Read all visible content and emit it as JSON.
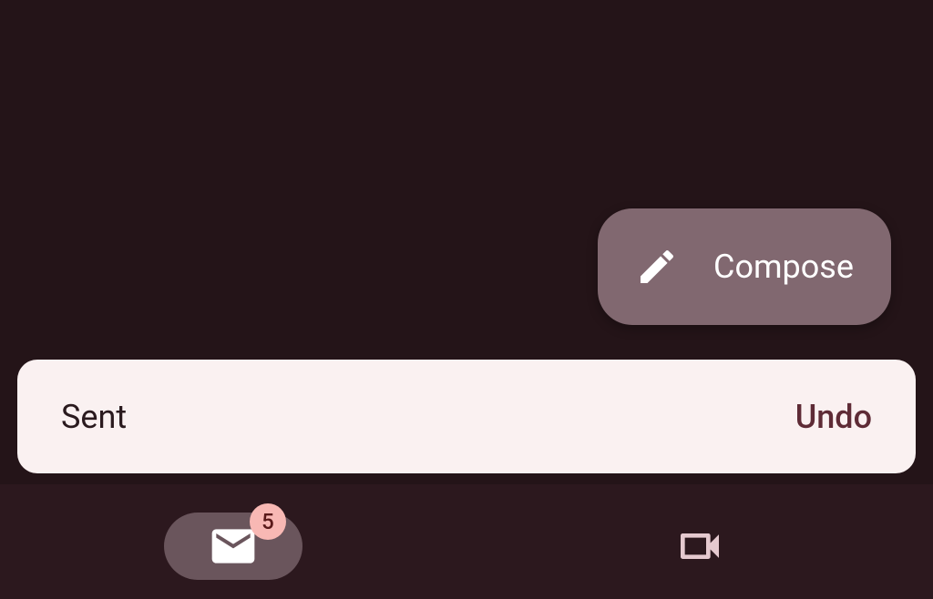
{
  "compose": {
    "label": "Compose"
  },
  "snackbar": {
    "message": "Sent",
    "action": "Undo"
  },
  "nav": {
    "mail": {
      "badge": "5"
    }
  }
}
